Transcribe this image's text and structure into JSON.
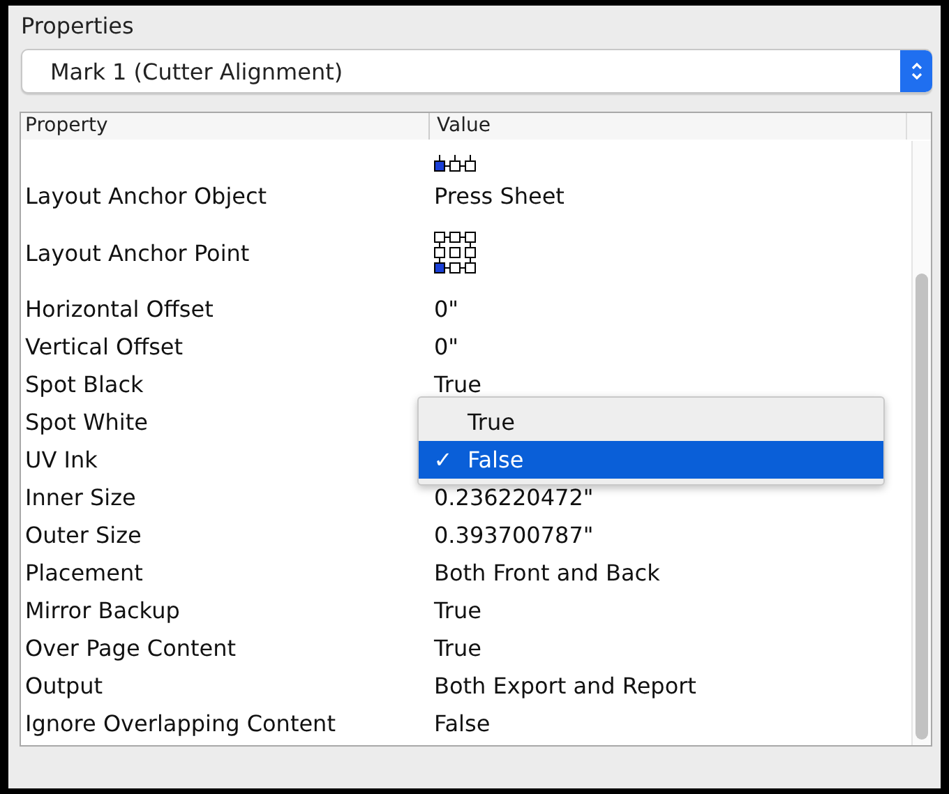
{
  "panel": {
    "title": "Properties"
  },
  "selector": {
    "value": "Mark 1 (Cutter Alignment)"
  },
  "table": {
    "columns": [
      "Property",
      "Value"
    ],
    "rows": [
      {
        "kind": "anchor_row",
        "points": [
          {
            "selected": true
          },
          {
            "selected": false
          },
          {
            "selected": false
          }
        ]
      },
      {
        "kind": "text",
        "label": "Layout Anchor Object",
        "value": "Press Sheet"
      },
      {
        "kind": "anchor",
        "label": "Layout Anchor Point",
        "points": [
          {
            "selected": false
          },
          {
            "selected": false
          },
          {
            "selected": false
          },
          {
            "selected": false
          },
          {
            "selected": false
          },
          {
            "selected": false
          },
          {
            "selected": true
          },
          {
            "selected": false
          },
          {
            "selected": false
          }
        ]
      },
      {
        "kind": "text",
        "label": "Horizontal Offset",
        "value": "0\""
      },
      {
        "kind": "text",
        "label": "Vertical Offset",
        "value": "0\""
      },
      {
        "kind": "text",
        "label": "Spot Black",
        "value": "True"
      },
      {
        "kind": "text",
        "label": "Spot White"
      },
      {
        "kind": "text",
        "label": "UV Ink"
      },
      {
        "kind": "text",
        "label": "Inner Size",
        "value": "0.236220472\""
      },
      {
        "kind": "text",
        "label": "Outer Size",
        "value": "0.393700787\""
      },
      {
        "kind": "text",
        "label": "Placement",
        "value": "Both Front and Back"
      },
      {
        "kind": "text",
        "label": "Mirror Backup",
        "value": "True"
      },
      {
        "kind": "text",
        "label": "Over Page Content",
        "value": "True"
      },
      {
        "kind": "text",
        "label": "Output",
        "value": "Both Export and Report"
      },
      {
        "kind": "text",
        "label": "Ignore Overlapping Content",
        "value": "False"
      }
    ]
  },
  "popup_menu": {
    "items": [
      {
        "label": "True",
        "selected": false
      },
      {
        "label": "False",
        "selected": true
      }
    ]
  },
  "checkmark": "✓"
}
